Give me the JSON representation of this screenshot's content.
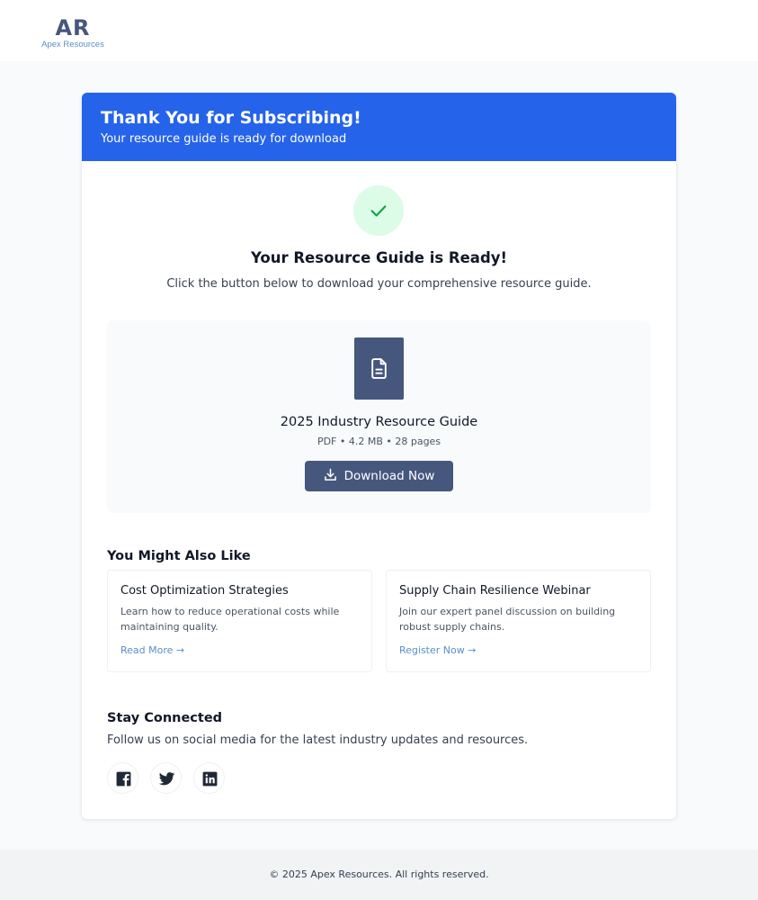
{
  "brand": {
    "logo_mark": "AR",
    "name": "Apex Resources"
  },
  "hero": {
    "title": "Thank You for Subscribing!",
    "subtitle": "Your resource guide is ready for download"
  },
  "confirmation": {
    "icon": "check-icon",
    "title": "Your Resource Guide is Ready!",
    "description": "Click the button below to download your comprehensive resource guide."
  },
  "download": {
    "icon": "document-icon",
    "title": "2025 Industry Resource Guide",
    "meta": "PDF • 4.2 MB • 28 pages",
    "button_label": "Download Now",
    "button_icon": "download-icon"
  },
  "related": {
    "heading": "You Might Also Like",
    "items": [
      {
        "title": "Cost Optimization Strategies",
        "description": "Learn how to reduce operational costs while maintaining quality.",
        "link": "Read More →"
      },
      {
        "title": "Supply Chain Resilience Webinar",
        "description": "Join our expert panel discussion on building robust supply chains.",
        "link": "Register Now →"
      }
    ]
  },
  "social": {
    "heading": "Stay Connected",
    "description": "Follow us on social media for the latest industry updates and resources.",
    "icons": [
      "facebook-icon",
      "twitter-icon",
      "linkedin-icon"
    ]
  },
  "footer": {
    "copyright": "© 2025 Apex Resources. All rights reserved."
  },
  "colors": {
    "primary": "#2563eb",
    "brand_slate": "#46577e",
    "link": "#5b8fc7",
    "success_bg": "#dcfce7",
    "success": "#16a34a"
  }
}
